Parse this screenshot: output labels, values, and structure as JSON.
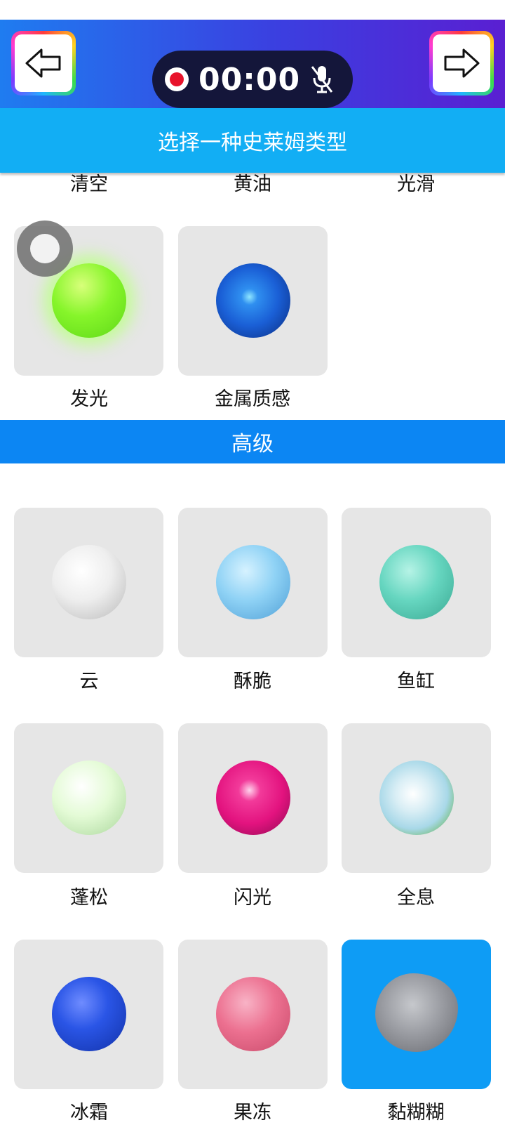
{
  "header": {
    "title": "史莱姆类型",
    "back_icon": "arrow-left-icon",
    "next_icon": "arrow-right-icon"
  },
  "recorder": {
    "time": "00:00",
    "record_icon": "record-dot-icon",
    "mic_icon": "mic-muted-icon"
  },
  "subheader": {
    "text": "选择一种史莱姆类型"
  },
  "top_row_labels": [
    "清空",
    "黄油",
    "光滑"
  ],
  "basic_items": [
    {
      "label": "发光",
      "color": "#86f52a"
    },
    {
      "label": "金属质感",
      "color": "#1a5fd6"
    }
  ],
  "section": {
    "title": "高级"
  },
  "advanced_items": [
    {
      "label": "云",
      "color": "#e9e9e9"
    },
    {
      "label": "酥脆",
      "color": "#8fd2f5"
    },
    {
      "label": "鱼缸",
      "color": "#66d6c0"
    },
    {
      "label": "蓬松",
      "color": "#e4fbd6"
    },
    {
      "label": "闪光",
      "color": "#e3137f"
    },
    {
      "label": "全息",
      "color": "#a8d8e8"
    },
    {
      "label": "冰霜",
      "color": "#1e47d8"
    },
    {
      "label": "果冻",
      "color": "#ec7090"
    },
    {
      "label": "黏糊糊",
      "color": "#8a8c92",
      "selected": true
    }
  ],
  "colors": {
    "header_start": "#1f7cf0",
    "header_end": "#5a1fd2",
    "subheader": "#12aef4",
    "section_bar": "#0c86f3",
    "selected_card": "#0e9cf5"
  }
}
